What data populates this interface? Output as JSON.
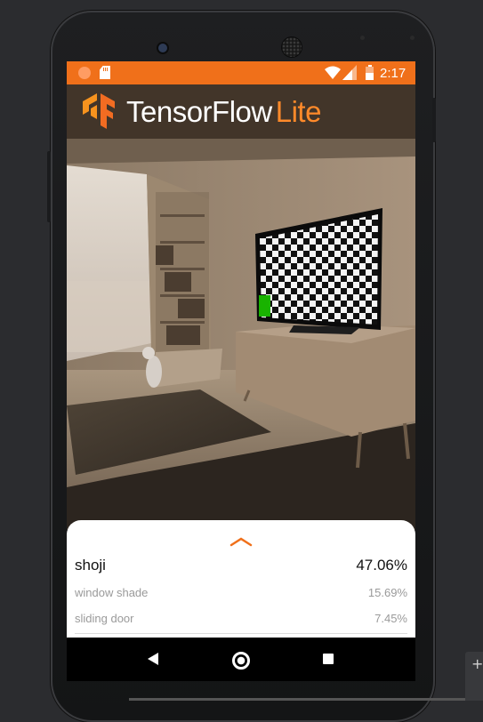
{
  "status_bar": {
    "time": "2:17",
    "icons": [
      "notification-circle-icon",
      "sd-card-icon",
      "wifi-icon",
      "cell-signal-icon",
      "battery-icon"
    ],
    "battery_level": 0.55,
    "background": "#f0701a"
  },
  "app_bar": {
    "logo_icon": "tensorflow-logo-icon",
    "brand_primary": "TensorFlow",
    "brand_secondary": "Lite",
    "secondary_color": "#ff8a2a"
  },
  "bottom_sheet": {
    "expand_icon": "chevron-up-icon",
    "accent": "#f0701a",
    "results": [
      {
        "label": "shoji",
        "value": "47.06%"
      },
      {
        "label": "window shade",
        "value": "15.69%"
      },
      {
        "label": "sliding door",
        "value": "7.45%"
      }
    ]
  },
  "nav_bar": {
    "icons": [
      "back-icon",
      "home-icon",
      "recents-icon"
    ]
  },
  "emulator_controls": {
    "icons": [
      "plus-icon"
    ],
    "plus_label": "+"
  }
}
